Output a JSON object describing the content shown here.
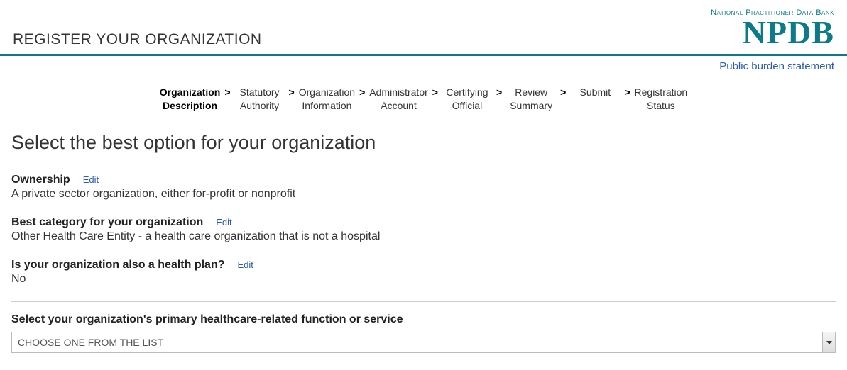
{
  "header": {
    "page_title": "REGISTER YOUR ORGANIZATION",
    "logo_top": "National Practitioner Data Bank",
    "logo_main": "NPDB",
    "burden_link": "Public burden statement"
  },
  "stepper": {
    "steps": [
      {
        "line1": "Organization",
        "line2": "Description",
        "active": true
      },
      {
        "line1": "Statutory",
        "line2": "Authority",
        "active": false
      },
      {
        "line1": "Organization",
        "line2": "Information",
        "active": false
      },
      {
        "line1": "Administrator",
        "line2": "Account",
        "active": false
      },
      {
        "line1": "Certifying",
        "line2": "Official",
        "active": false
      },
      {
        "line1": "Review",
        "line2": "Summary",
        "active": false
      },
      {
        "line1": "Submit",
        "line2": "",
        "active": false
      },
      {
        "line1": "Registration",
        "line2": "Status",
        "active": false
      }
    ]
  },
  "main": {
    "heading": "Select the best option for your organization",
    "ownership": {
      "label": "Ownership",
      "edit": "Edit",
      "value": "A private sector organization, either for-profit or nonprofit"
    },
    "category": {
      "label": "Best category for your organization",
      "edit": "Edit",
      "value": "Other Health Care Entity - a health care organization that is not a hospital"
    },
    "healthplan": {
      "label": "Is your organization also a health plan?",
      "edit": "Edit",
      "value": "No"
    },
    "primary_function": {
      "label": "Select your organization's primary healthcare-related function or service",
      "placeholder": "CHOOSE ONE FROM THE LIST"
    }
  }
}
